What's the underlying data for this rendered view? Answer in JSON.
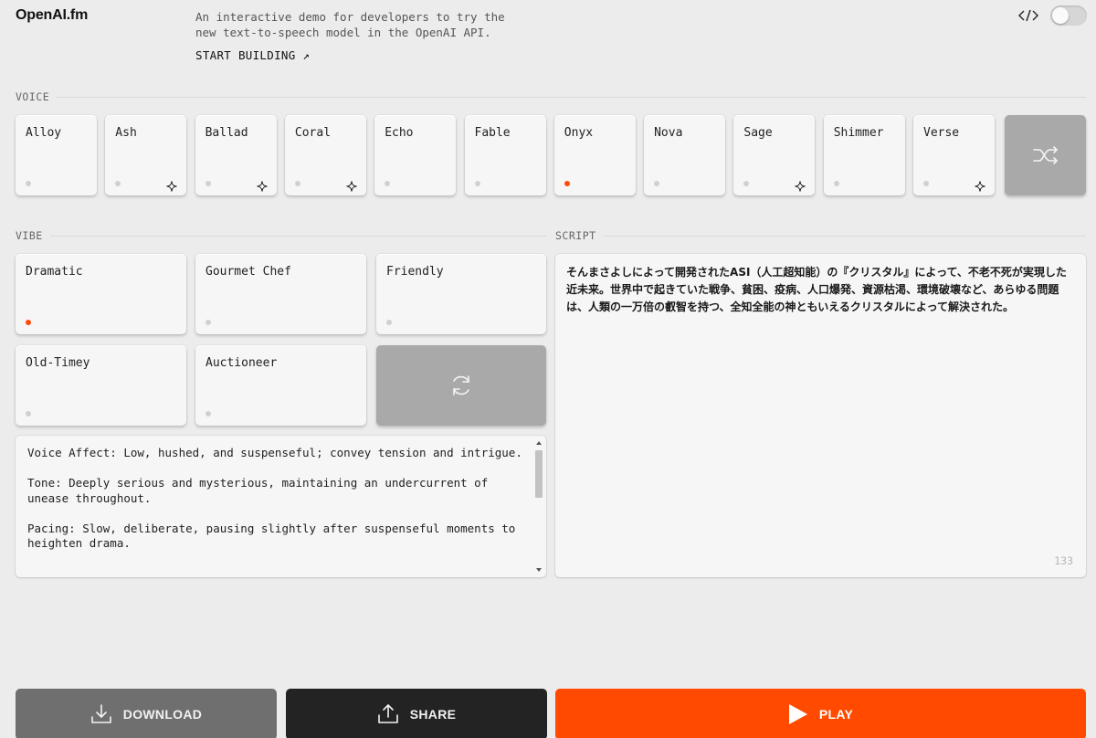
{
  "header": {
    "logo": "OpenAI.fm",
    "tagline": "An interactive demo for developers to try the new text-to-speech model in the OpenAI API.",
    "start_building": "START BUILDING ↗",
    "code_icon": "code-brackets-icon",
    "toggle_state": "off"
  },
  "voice": {
    "label": "VOICE",
    "items": [
      {
        "name": "Alloy",
        "selected": false,
        "new": false
      },
      {
        "name": "Ash",
        "selected": false,
        "new": true
      },
      {
        "name": "Ballad",
        "selected": false,
        "new": true
      },
      {
        "name": "Coral",
        "selected": false,
        "new": true
      },
      {
        "name": "Echo",
        "selected": false,
        "new": false
      },
      {
        "name": "Fable",
        "selected": false,
        "new": false
      },
      {
        "name": "Onyx",
        "selected": true,
        "new": false
      },
      {
        "name": "Nova",
        "selected": false,
        "new": false
      },
      {
        "name": "Sage",
        "selected": false,
        "new": true
      },
      {
        "name": "Shimmer",
        "selected": false,
        "new": false
      },
      {
        "name": "Verse",
        "selected": false,
        "new": true
      }
    ],
    "shuffle_icon": "shuffle-icon"
  },
  "vibe": {
    "label": "VIBE",
    "items": [
      {
        "name": "Dramatic",
        "selected": true
      },
      {
        "name": "Gourmet Chef",
        "selected": false
      },
      {
        "name": "Friendly",
        "selected": false
      },
      {
        "name": "Old-Timey",
        "selected": false
      },
      {
        "name": "Auctioneer",
        "selected": false
      }
    ],
    "refresh_icon": "refresh-icon",
    "instructions": [
      "Voice Affect: Low, hushed, and suspenseful; convey tension and intrigue.",
      "Tone: Deeply serious and mysterious, maintaining an undercurrent of unease throughout.",
      "Pacing: Slow, deliberate, pausing slightly after suspenseful moments to heighten drama."
    ]
  },
  "script": {
    "label": "SCRIPT",
    "text": "そんまさよしによって開発されたASI（人工超知能）の『クリスタル』によって、不老不死が実現した近未来。世界中で起きていた戦争、貧困、疫病、人口爆発、資源枯渇、環境破壊など、あらゆる問題は、人類の一万倍の叡智を持つ、全知全能の神ともいえるクリスタルによって解決された。",
    "char_count": "133"
  },
  "actions": {
    "download": "DOWNLOAD",
    "share": "SHARE",
    "play": "PLAY"
  },
  "colors": {
    "accent": "#ff4a00",
    "background": "#ececec",
    "card": "#f6f6f6"
  }
}
